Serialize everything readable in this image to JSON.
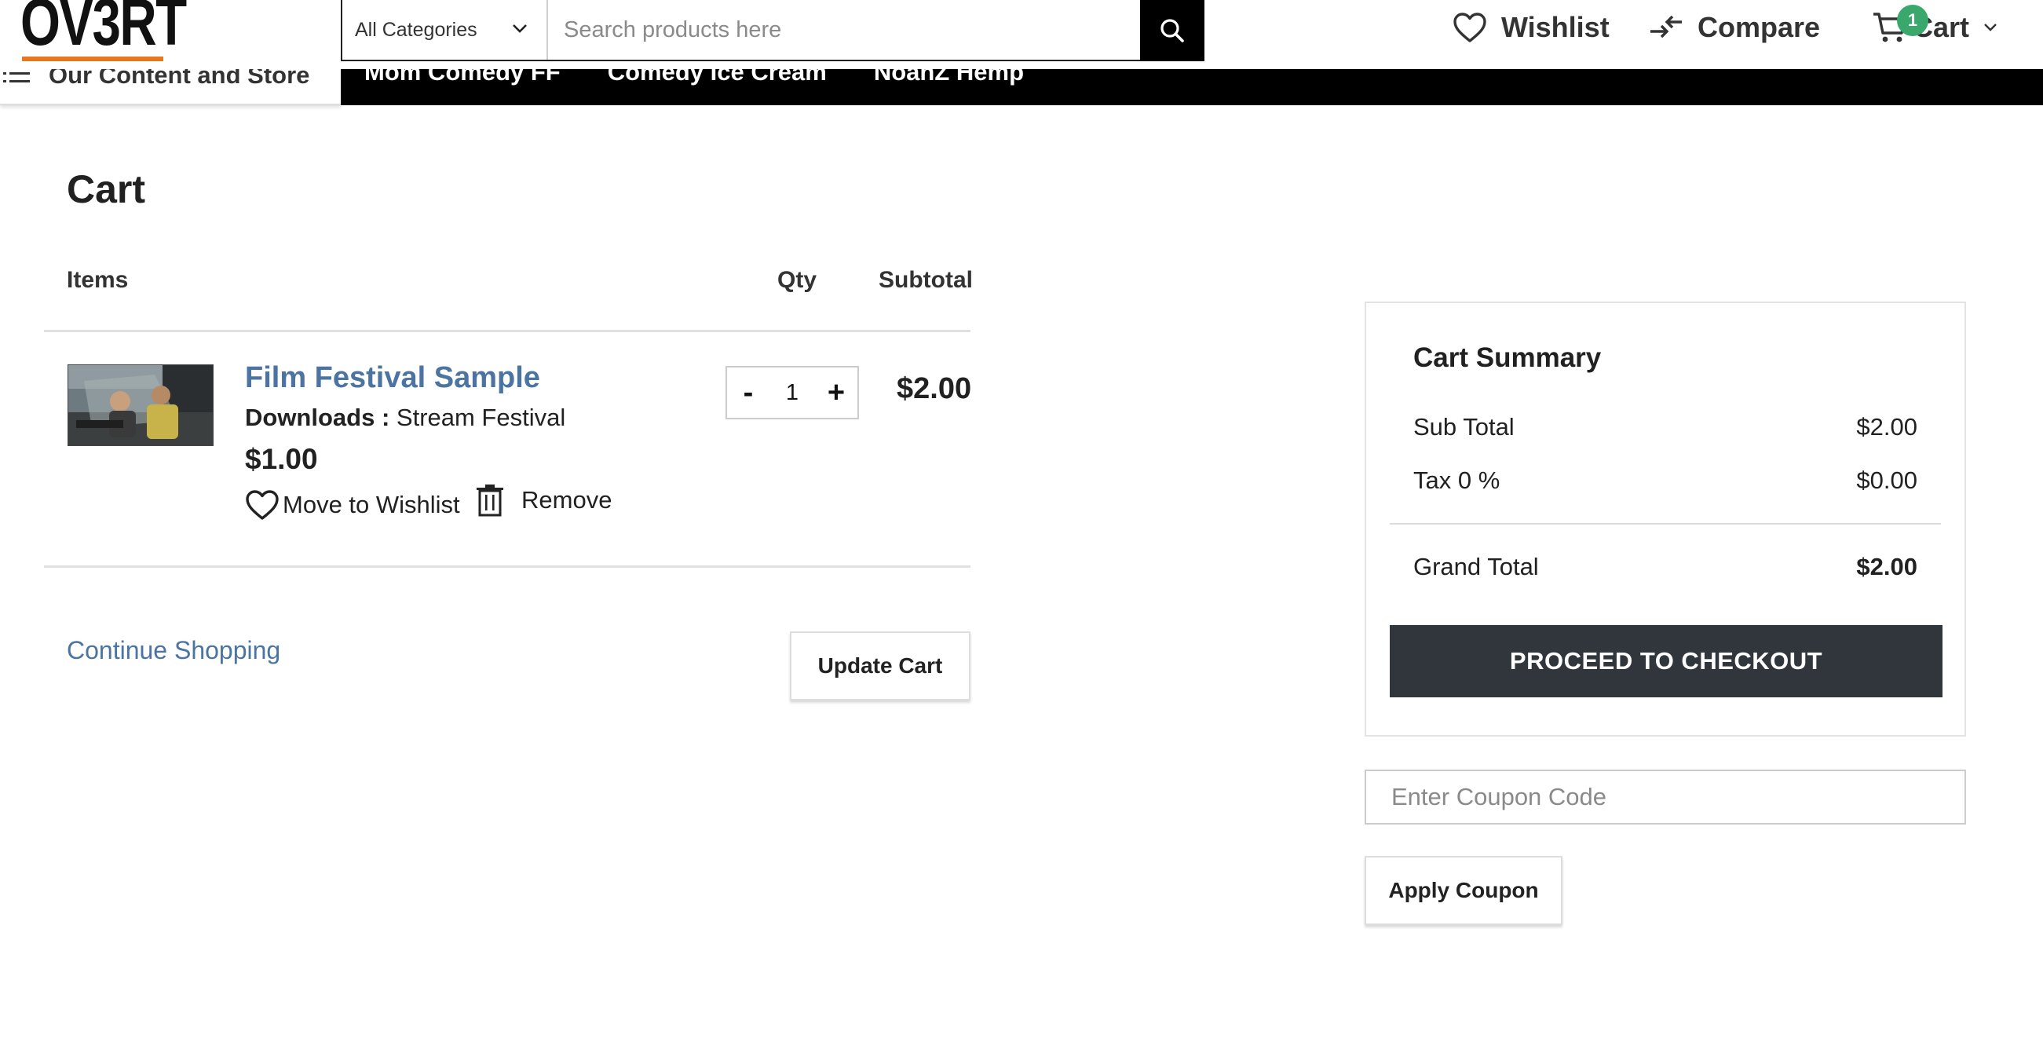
{
  "header": {
    "logo": "OV3RT",
    "search": {
      "category": "All Categories",
      "placeholder": "Search products here"
    },
    "wishlist_label": "Wishlist",
    "compare_label": "Compare",
    "cart_label": "Cart",
    "cart_count": "1",
    "accent_color": "#e87722",
    "badge_color": "#3aa76d"
  },
  "nav": {
    "menu_label": "Our Content and Store",
    "items": [
      {
        "label": "Mom Comedy FF"
      },
      {
        "label": "Comedy Ice Cream"
      },
      {
        "label": "NoahZ Hemp"
      }
    ]
  },
  "cart": {
    "title": "Cart",
    "columns": {
      "items": "Items",
      "qty": "Qty",
      "subtotal": "Subtotal"
    },
    "rows": [
      {
        "name": "Film Festival Sample",
        "option_label": "Downloads :",
        "option_value": "Stream Festival",
        "price": "$1.00",
        "qty": "1",
        "subtotal": "$2.00",
        "move_to_wishlist": "Move to Wishlist",
        "remove": "Remove",
        "qty_minus": "-",
        "qty_plus": "+"
      }
    ],
    "continue_shopping": "Continue Shopping",
    "update_cart": "Update Cart"
  },
  "summary": {
    "title": "Cart Summary",
    "sub_total_label": "Sub Total",
    "sub_total": "$2.00",
    "tax_label": "Tax 0 %",
    "tax": "$0.00",
    "grand_total_label": "Grand Total",
    "grand_total": "$2.00",
    "checkout_label": "PROCEED TO CHECKOUT",
    "checkout_color": "#31363c"
  },
  "coupon": {
    "placeholder": "Enter Coupon Code",
    "apply_label": "Apply Coupon"
  }
}
